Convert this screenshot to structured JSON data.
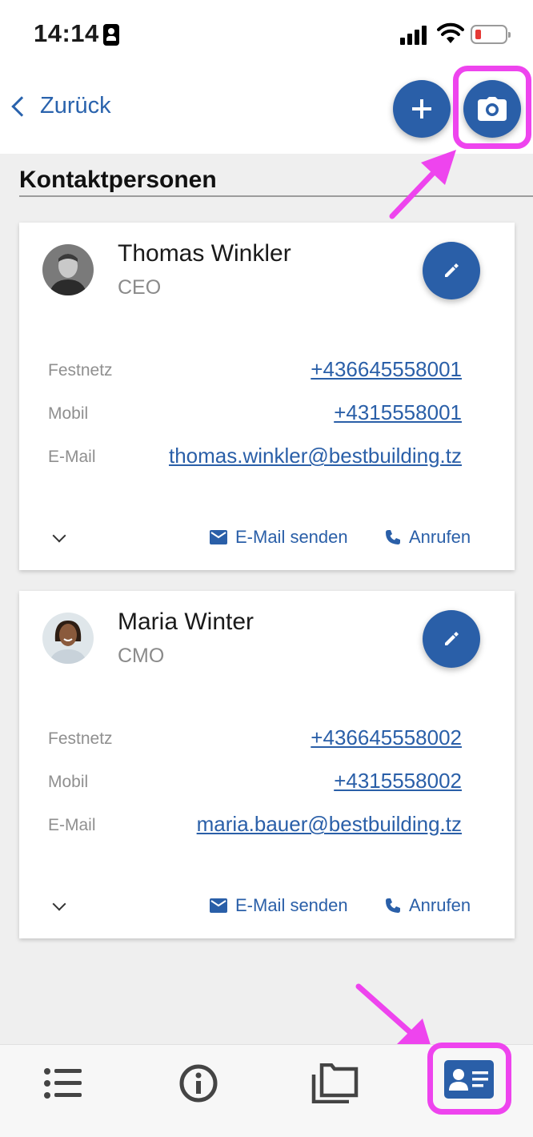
{
  "status_bar": {
    "time": "14:14",
    "icons": [
      "contact-card-icon",
      "cellular-signal-icon",
      "wifi-icon",
      "battery-low-icon"
    ]
  },
  "nav": {
    "back_label": "Zurück",
    "add_icon": "plus-icon",
    "camera_icon": "camera-icon"
  },
  "section": {
    "title": "Kontaktpersonen"
  },
  "contacts": [
    {
      "name": "Thomas Winkler",
      "role": "CEO",
      "landline_label": "Festnetz",
      "landline": "+436645558001",
      "mobile_label": "Mobil",
      "mobile": "+4315558001",
      "email_label": "E-Mail",
      "email": "thomas.winkler@bestbuilding.tz",
      "send_email_label": "E-Mail senden",
      "call_label": "Anrufen"
    },
    {
      "name": "Maria Winter",
      "role": "CMO",
      "landline_label": "Festnetz",
      "landline": "+436645558002",
      "mobile_label": "Mobil",
      "mobile": "+4315558002",
      "email_label": "E-Mail",
      "email": "maria.bauer@bestbuilding.tz",
      "send_email_label": "E-Mail senden",
      "call_label": "Anrufen"
    }
  ],
  "tab_bar": {
    "tabs": [
      {
        "icon": "list-icon",
        "active": false
      },
      {
        "icon": "info-icon",
        "active": false
      },
      {
        "icon": "folders-icon",
        "active": false
      },
      {
        "icon": "contact-card-icon",
        "active": true
      }
    ]
  },
  "colors": {
    "accent": "#2a5fa8",
    "highlight": "#ee44ee",
    "background": "#efefef"
  }
}
